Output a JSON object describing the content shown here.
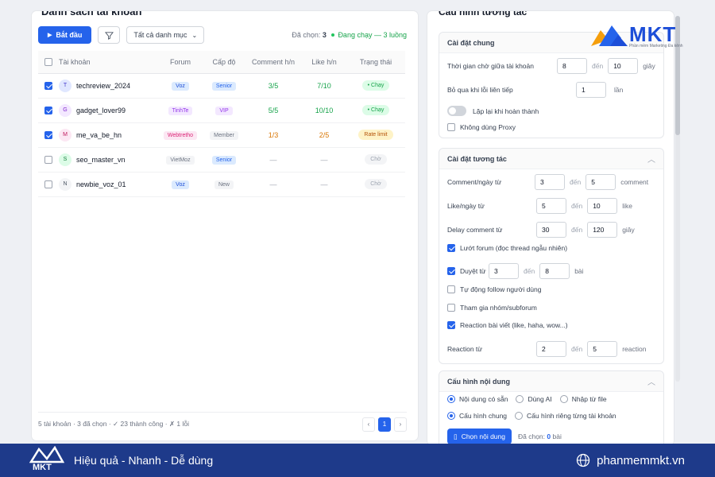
{
  "left": {
    "title": "Danh sách tài khoản",
    "start_button": "Bắt đầu",
    "category_select": "Tất cả danh mục",
    "status": {
      "selected_label": "Đã chọn:",
      "selected_count": "3",
      "running": "Đang chạy — 3 luồng"
    },
    "columns": [
      "Tài khoản",
      "Forum",
      "Cấp độ",
      "Comment h/n",
      "Like h/n",
      "Trạng thái"
    ],
    "rows": [
      {
        "checked": true,
        "initial": "T",
        "account": "techreview_2024",
        "forum": "Voz",
        "level": "Senior",
        "comment": "3/5",
        "like": "7/10",
        "status": "• Chạy"
      },
      {
        "checked": true,
        "initial": "G",
        "account": "gadget_lover99",
        "forum": "TinhTe",
        "level": "VIP",
        "comment": "5/5",
        "like": "10/10",
        "status": "• Chạy"
      },
      {
        "checked": true,
        "initial": "M",
        "account": "me_va_be_hn",
        "forum": "Webtretho",
        "level": "Member",
        "comment": "1/3",
        "like": "2/5",
        "status": "Rate limit"
      },
      {
        "checked": false,
        "initial": "S",
        "account": "seo_master_vn",
        "forum": "VietMoz",
        "level": "Senior",
        "comment": "—",
        "like": "—",
        "status": "Chờ"
      },
      {
        "checked": false,
        "initial": "N",
        "account": "newbie_voz_01",
        "forum": "Voz",
        "level": "New",
        "comment": "—",
        "like": "—",
        "status": "Chờ"
      }
    ],
    "footer": "5 tài khoản · 3 đã chọn · ✓ 23 thành công · ✗ 1 lỗi",
    "pagination": {
      "prev": "‹",
      "page": "1",
      "next": "›"
    }
  },
  "right": {
    "title": "Cấu hình tương tác",
    "general": {
      "heading": "Cài đặt chung",
      "wait_label": "Thời gian chờ giữa tài khoản",
      "wait_from": "8",
      "to": "đến",
      "wait_to": "10",
      "wait_unit": "giây",
      "skip_label": "Bỏ qua khi lỗi liên tiếp",
      "skip_value": "1",
      "skip_unit": "lần",
      "repeat_label": "Lặp lại khi hoàn thành",
      "no_proxy_label": "Không dùng Proxy"
    },
    "interaction": {
      "heading": "Cài đặt tương tác",
      "comment_label": "Comment/ngày từ",
      "comment_from": "3",
      "comment_to": "5",
      "comment_unit": "comment",
      "like_label": "Like/ngày từ",
      "like_from": "5",
      "like_to": "10",
      "like_unit": "like",
      "delay_label": "Delay comment từ",
      "delay_from": "30",
      "delay_to": "120",
      "delay_unit": "giây",
      "browse_label": "Lướt forum (đọc thread ngẫu nhiên)",
      "scan_label": "Duyệt từ",
      "scan_from": "3",
      "scan_to": "8",
      "scan_unit": "bài",
      "follow_label": "Tự động follow người dùng",
      "join_label": "Tham gia nhóm/subforum",
      "reaction_check_label": "Reaction bài viết (like, haha, wow...)",
      "reaction_label": "Reaction từ",
      "reaction_from": "2",
      "reaction_to": "5",
      "reaction_unit": "reaction",
      "to": "đến"
    },
    "content": {
      "heading": "Cấu hình nội dung",
      "source_options": [
        "Nội dung có sẵn",
        "Dùng AI",
        "Nhập từ file"
      ],
      "mode_options": [
        "Cấu hình chung",
        "Cấu hình riêng từng tài khoản"
      ],
      "choose_button": "Chọn nội dung",
      "selected_label": "Đã chọn:",
      "selected_count": "0",
      "selected_unit": "bài"
    }
  },
  "logo": {
    "text": "MKT",
    "subtitle": "Phần mềm Marketing Đa kênh"
  },
  "banner": {
    "logo_text": "MKT",
    "slogan": "Hiệu quả - Nhanh - Dễ dùng",
    "website": "phanmemmkt.vn"
  },
  "colors": {
    "accent": "#2563eb",
    "banner": "#1e3a8a",
    "success": "#16a34a",
    "warning": "#d97706"
  }
}
